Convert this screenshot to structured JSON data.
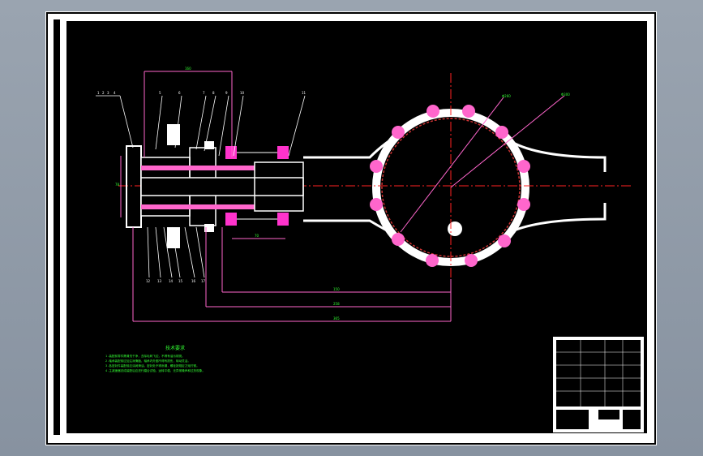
{
  "drawing": {
    "tech_requirements": {
      "title": "技术要求",
      "lines": [
        "1.装配前零件需清洗干净，去除毛刺飞边，不得有油污锈斑。",
        "2.轴承装配前应加注润滑脂，轴承内外圈不得有损伤，转动灵活。",
        "3.各密封件装配前应涂润滑油，密封处不得渗漏，螺栓按规定力矩拧紧。",
        "4.主减速器总成装配后应进行磨合试验，运转平稳，无异常噪声和过热现象。"
      ]
    },
    "part_callouts_top": [
      "1",
      "2",
      "3",
      "4",
      "5",
      "6",
      "7",
      "8",
      "9",
      "10",
      "11"
    ],
    "part_callouts_bottom": [
      "12",
      "13",
      "14",
      "15",
      "16",
      "17"
    ],
    "dimensions": {
      "top": "160",
      "left_vertical": "78",
      "under_flange": "70",
      "d1": "150",
      "d2": "258",
      "d3": "365",
      "leader_a": "Φ260",
      "leader_b": "Φ300"
    },
    "colors": {
      "background": "#000000",
      "outline": "#ffffff",
      "bearing": "#ff33cc",
      "dimension": "#ff66cc",
      "centerline": "#ff2222",
      "text": "#33ff33"
    }
  }
}
